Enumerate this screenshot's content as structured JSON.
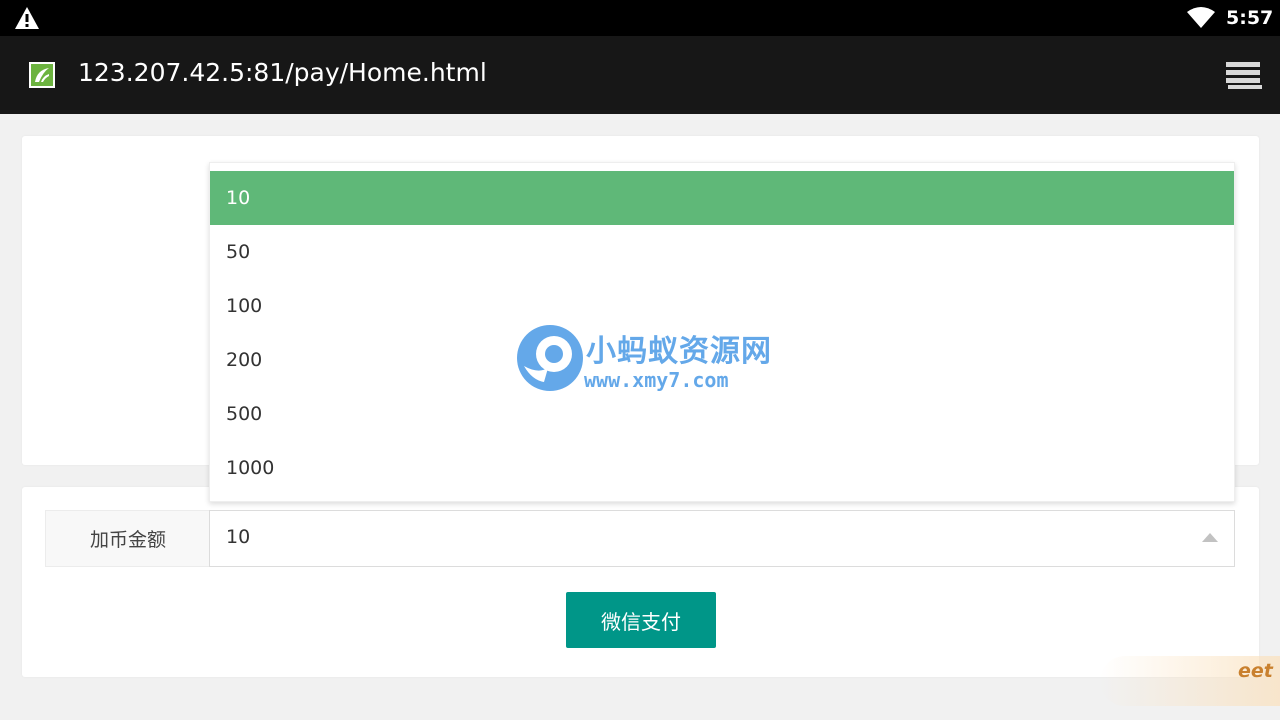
{
  "status_bar": {
    "warning_icon": "warning-triangle-icon",
    "wifi_icon": "wifi-icon",
    "time": "5:57"
  },
  "browser": {
    "favicon": "site-favicon-icon",
    "url": "123.207.42.5:81/pay/Home.html",
    "menu_icon": "menu-stack-icon"
  },
  "form": {
    "amount_label": "加币金额",
    "amount_value": "10",
    "pay_button_label": "微信支付",
    "options": [
      {
        "label": "10",
        "selected": true
      },
      {
        "label": "50",
        "selected": false
      },
      {
        "label": "100",
        "selected": false
      },
      {
        "label": "200",
        "selected": false
      },
      {
        "label": "500",
        "selected": false
      },
      {
        "label": "1000",
        "selected": false
      }
    ]
  },
  "watermark": {
    "name": "小蚂蚁资源网",
    "site": "www.xmy7.com",
    "corner_text": "eet"
  },
  "colors": {
    "selected_option": "#5fb878",
    "pay_button": "#009688",
    "appbar": "#171717",
    "watermark": "#4a9ae6"
  }
}
